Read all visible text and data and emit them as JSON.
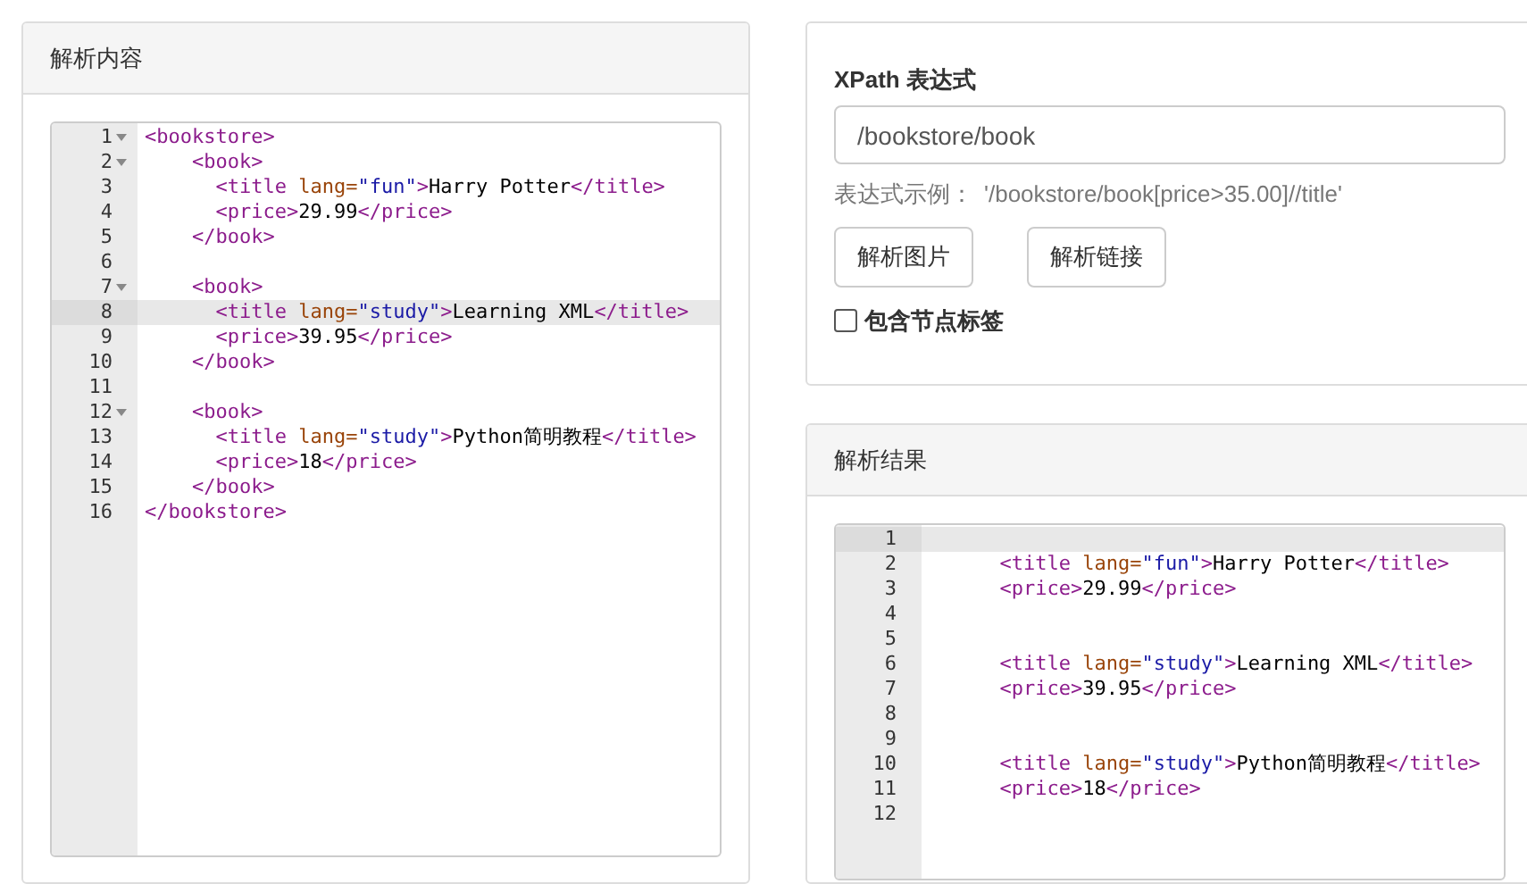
{
  "source_panel": {
    "title": "解析内容",
    "editor": {
      "lines": [
        {
          "number": "1",
          "fold": true,
          "active": false,
          "tokens": [
            {
              "kind": "tag",
              "text": "<bookstore>"
            }
          ]
        },
        {
          "number": "2",
          "fold": true,
          "active": false,
          "tokens": [
            {
              "kind": "tag",
              "text": "    <book>"
            }
          ]
        },
        {
          "number": "3",
          "fold": false,
          "active": false,
          "tokens": [
            {
              "kind": "tag",
              "text": "      <title "
            },
            {
              "kind": "attr",
              "text": "lang="
            },
            {
              "kind": "string",
              "text": "\"fun\""
            },
            {
              "kind": "tag",
              "text": ">"
            },
            {
              "kind": "text",
              "text": "Harry Potter"
            },
            {
              "kind": "tag",
              "text": "</title>"
            }
          ]
        },
        {
          "number": "4",
          "fold": false,
          "active": false,
          "tokens": [
            {
              "kind": "tag",
              "text": "      <price>"
            },
            {
              "kind": "text",
              "text": "29.99"
            },
            {
              "kind": "tag",
              "text": "</price>"
            }
          ]
        },
        {
          "number": "5",
          "fold": false,
          "active": false,
          "tokens": [
            {
              "kind": "tag",
              "text": "    </book>"
            }
          ]
        },
        {
          "number": "6",
          "fold": false,
          "active": false
        },
        {
          "number": "7",
          "fold": true,
          "active": false,
          "tokens": [
            {
              "kind": "tag",
              "text": "    <book>"
            }
          ]
        },
        {
          "number": "8",
          "fold": false,
          "active": true,
          "tokens": [
            {
              "kind": "tag",
              "text": "      <title "
            },
            {
              "kind": "attr",
              "text": "lang="
            },
            {
              "kind": "string",
              "text": "\"study\""
            },
            {
              "kind": "tag",
              "text": ">"
            },
            {
              "kind": "text",
              "text": "Learning XML"
            },
            {
              "kind": "tag",
              "text": "</title>"
            }
          ]
        },
        {
          "number": "9",
          "fold": false,
          "active": false,
          "tokens": [
            {
              "kind": "tag",
              "text": "      <price>"
            },
            {
              "kind": "text",
              "text": "39.95"
            },
            {
              "kind": "tag",
              "text": "</price>"
            }
          ]
        },
        {
          "number": "10",
          "fold": false,
          "active": false,
          "tokens": [
            {
              "kind": "tag",
              "text": "    </book>"
            }
          ]
        },
        {
          "number": "11",
          "fold": false,
          "active": false
        },
        {
          "number": "12",
          "fold": true,
          "active": false,
          "tokens": [
            {
              "kind": "tag",
              "text": "    <book>"
            }
          ]
        },
        {
          "number": "13",
          "fold": false,
          "active": false,
          "tokens": [
            {
              "kind": "tag",
              "text": "      <title "
            },
            {
              "kind": "attr",
              "text": "lang="
            },
            {
              "kind": "string",
              "text": "\"study\""
            },
            {
              "kind": "tag",
              "text": ">"
            },
            {
              "kind": "text",
              "text": "Python简明教程"
            },
            {
              "kind": "tag",
              "text": "</title>"
            }
          ]
        },
        {
          "number": "14",
          "fold": false,
          "active": false,
          "tokens": [
            {
              "kind": "tag",
              "text": "      <price>"
            },
            {
              "kind": "text",
              "text": "18"
            },
            {
              "kind": "tag",
              "text": "</price>"
            }
          ]
        },
        {
          "number": "15",
          "fold": false,
          "active": false,
          "tokens": [
            {
              "kind": "tag",
              "text": "    </book>"
            }
          ]
        },
        {
          "number": "16",
          "fold": false,
          "active": false,
          "tokens": [
            {
              "kind": "tag",
              "text": "</bookstore>"
            }
          ]
        }
      ]
    }
  },
  "xpath_panel": {
    "label": "XPath 表达式",
    "input": {
      "value": "/bookstore/book"
    },
    "hint_label": "表达式示例：",
    "hint_example": "'/bookstore/book[price>35.00]//title'",
    "buttons": [
      "解析图片",
      "解析链接"
    ],
    "checkbox": {
      "label": "包含节点标签",
      "checked": false
    }
  },
  "result_panel": {
    "title": "解析结果",
    "editor": {
      "lines": [
        {
          "number": "1",
          "fold": false,
          "active": true
        },
        {
          "number": "2",
          "fold": false,
          "active": false,
          "tokens": [
            {
              "kind": "tag",
              "text": "      <title "
            },
            {
              "kind": "attr",
              "text": "lang="
            },
            {
              "kind": "string",
              "text": "\"fun\""
            },
            {
              "kind": "tag",
              "text": ">"
            },
            {
              "kind": "text",
              "text": "Harry Potter"
            },
            {
              "kind": "tag",
              "text": "</title>"
            }
          ]
        },
        {
          "number": "3",
          "fold": false,
          "active": false,
          "tokens": [
            {
              "kind": "tag",
              "text": "      <price>"
            },
            {
              "kind": "text",
              "text": "29.99"
            },
            {
              "kind": "tag",
              "text": "</price>"
            }
          ]
        },
        {
          "number": "4",
          "fold": false,
          "active": false
        },
        {
          "number": "5",
          "fold": false,
          "active": false
        },
        {
          "number": "6",
          "fold": false,
          "active": false,
          "tokens": [
            {
              "kind": "tag",
              "text": "      <title "
            },
            {
              "kind": "attr",
              "text": "lang="
            },
            {
              "kind": "string",
              "text": "\"study\""
            },
            {
              "kind": "tag",
              "text": ">"
            },
            {
              "kind": "text",
              "text": "Learning XML"
            },
            {
              "kind": "tag",
              "text": "</title>"
            }
          ]
        },
        {
          "number": "7",
          "fold": false,
          "active": false,
          "tokens": [
            {
              "kind": "tag",
              "text": "      <price>"
            },
            {
              "kind": "text",
              "text": "39.95"
            },
            {
              "kind": "tag",
              "text": "</price>"
            }
          ]
        },
        {
          "number": "8",
          "fold": false,
          "active": false
        },
        {
          "number": "9",
          "fold": false,
          "active": false
        },
        {
          "number": "10",
          "fold": false,
          "active": false,
          "tokens": [
            {
              "kind": "tag",
              "text": "      <title "
            },
            {
              "kind": "attr",
              "text": "lang="
            },
            {
              "kind": "string",
              "text": "\"study\""
            },
            {
              "kind": "tag",
              "text": ">"
            },
            {
              "kind": "text",
              "text": "Python简明教程"
            },
            {
              "kind": "tag",
              "text": "</title>"
            }
          ]
        },
        {
          "number": "11",
          "fold": false,
          "active": false,
          "tokens": [
            {
              "kind": "tag",
              "text": "      <price>"
            },
            {
              "kind": "text",
              "text": "18"
            },
            {
              "kind": "tag",
              "text": "</price>"
            }
          ]
        },
        {
          "number": "12",
          "fold": false,
          "active": false
        }
      ]
    }
  }
}
